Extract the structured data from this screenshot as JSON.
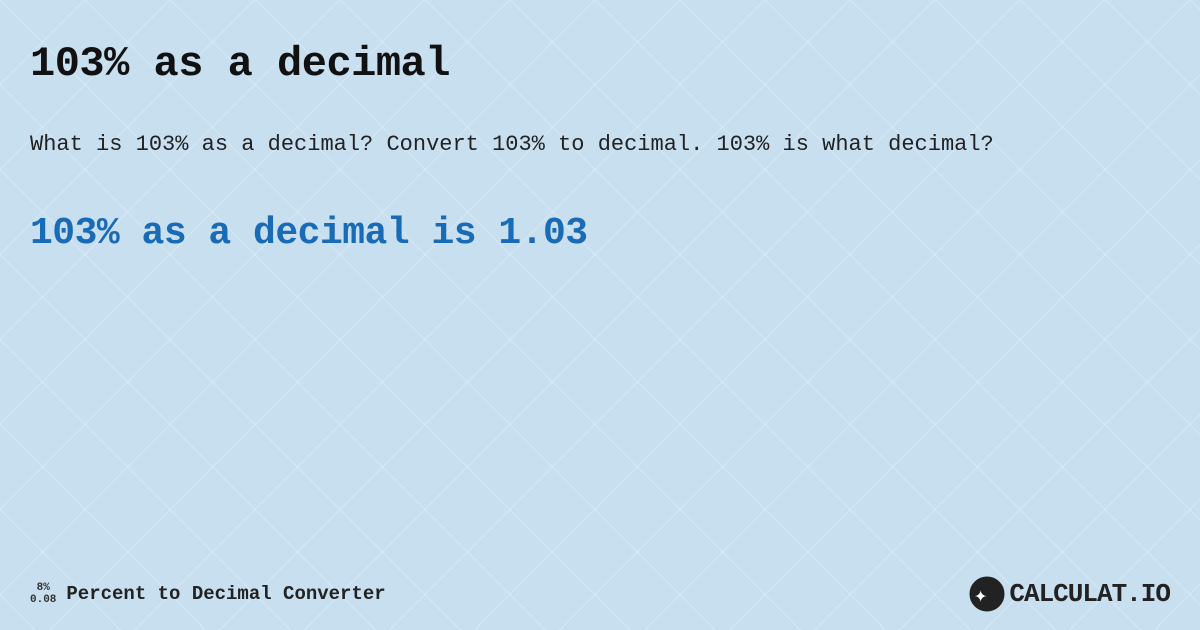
{
  "page": {
    "background_color": "#c8dff0",
    "title": "103% as a decimal",
    "description": "What is 103% as a decimal? Convert 103% to decimal. 103% is what decimal?",
    "result": "103% as a decimal is 1.03",
    "footer": {
      "fraction_top": "8%",
      "fraction_bottom": "0.08",
      "label": "Percent to Decimal Converter",
      "logo_text": "CALCULAT.IO"
    }
  }
}
